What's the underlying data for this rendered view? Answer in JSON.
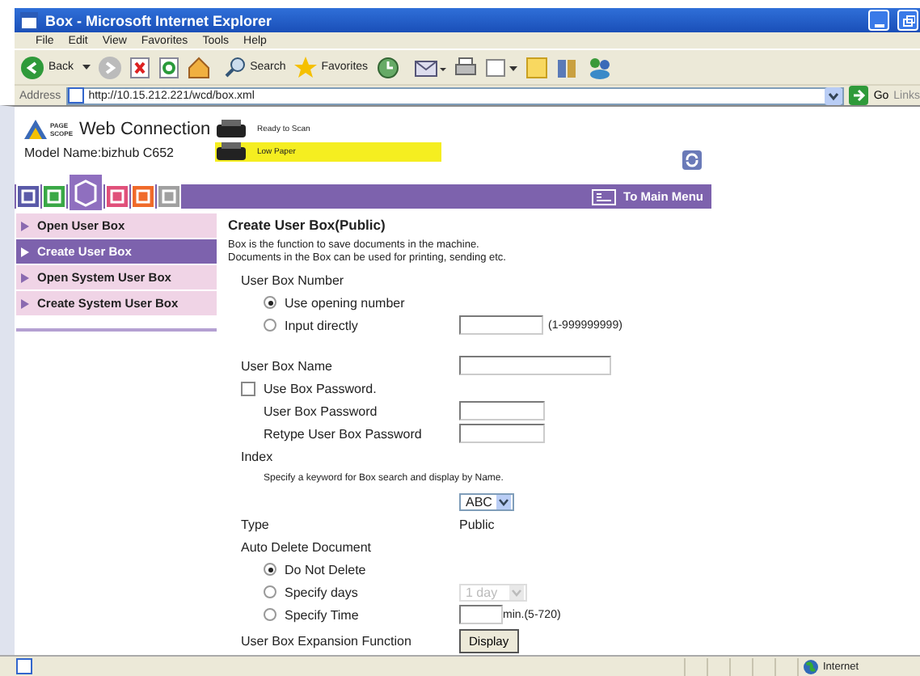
{
  "window": {
    "title": "Box - Microsoft Internet Explorer"
  },
  "menu": [
    "File",
    "Edit",
    "View",
    "Favorites",
    "Tools",
    "Help"
  ],
  "toolbar": {
    "back": "Back",
    "search": "Search",
    "favorites": "Favorites"
  },
  "address": {
    "label": "Address",
    "url": "http://10.15.212.221/wcd/box.xml",
    "go": "Go",
    "links": "Links"
  },
  "header": {
    "logo_small": "PAGE SCOPE",
    "logo": "Web Connection",
    "model": "Model Name:bizhub C652"
  },
  "device_status": [
    {
      "text": "Ready to Scan",
      "kind": "normal"
    },
    {
      "text": "Low Paper",
      "kind": "warning"
    }
  ],
  "tabs": [
    {
      "color": "#5a5aa8",
      "selected": false
    },
    {
      "color": "#3aa846",
      "selected": false
    },
    {
      "color": "#8f6fbf",
      "selected": true
    },
    {
      "color": "#e0507a",
      "selected": false
    },
    {
      "color": "#f06a2a",
      "selected": false
    },
    {
      "color": "#a0a0a0",
      "selected": false
    }
  ],
  "main_menu": "To Main Menu",
  "sidebar": [
    {
      "label": "Open User Box",
      "selected": false
    },
    {
      "label": "Create User Box",
      "selected": true
    },
    {
      "label": "Open System User Box",
      "selected": false
    },
    {
      "label": "Create System User Box",
      "selected": false
    }
  ],
  "form": {
    "title": "Create User Box(Public)",
    "description": [
      "Box is the function to save documents in the machine.",
      "Documents in the Box can be used for printing, sending etc."
    ],
    "number_label": "User Box Number",
    "number_options": [
      {
        "label": "Use opening number",
        "selected": true
      },
      {
        "label": "Input directly",
        "selected": false
      }
    ],
    "number_range": "(1-999999999)",
    "name_label": "User Box Name",
    "password_checkbox": {
      "label": "Use Box Password.",
      "checked": false
    },
    "password_label": "User Box Password",
    "retype_label": "Retype User Box Password",
    "index_label": "Index",
    "index_hint": "Specify a keyword for Box search and display by Name.",
    "index_value": "ABC",
    "type_label": "Type",
    "type_value": "Public",
    "auto_delete_label": "Auto Delete Document",
    "auto_delete_options": [
      {
        "label": "Do Not Delete",
        "selected": true
      },
      {
        "label": "Specify days",
        "selected": false
      },
      {
        "label": "Specify Time",
        "selected": false
      }
    ],
    "days_value": "1 day",
    "days_disabled": true,
    "time_unit": "min.(5-720)",
    "expansion_label": "User Box Expansion Function",
    "expansion_button": "Display"
  },
  "status_bar": {
    "zone": "Internet"
  }
}
